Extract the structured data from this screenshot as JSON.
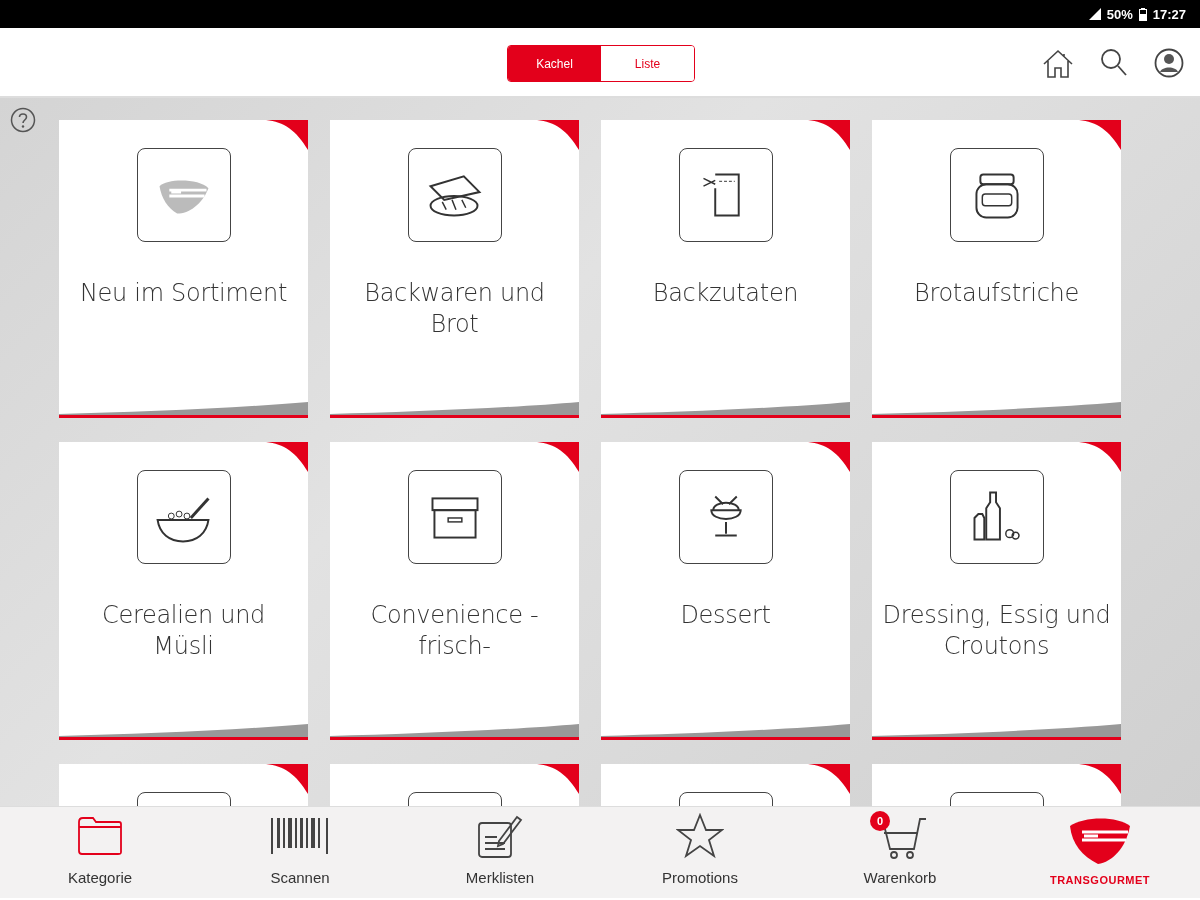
{
  "status_bar": {
    "battery": "50%",
    "time": "17:27"
  },
  "view_toggle": [
    {
      "label": "Kachel",
      "selected": true
    },
    {
      "label": "Liste",
      "selected": false
    }
  ],
  "tiles": [
    {
      "kind": "full",
      "label": "Neu im Sortiment"
    },
    {
      "kind": "full",
      "label": "Backwaren und Brot"
    },
    {
      "kind": "full",
      "label": "Backzutaten"
    },
    {
      "kind": "full",
      "label": "Brotaufstriche"
    },
    {
      "kind": "full",
      "label": "Cerealien und Müsli"
    },
    {
      "kind": "full",
      "label": "Convenience - frisch-"
    },
    {
      "kind": "full",
      "label": "Dessert"
    },
    {
      "kind": "full",
      "label": "Dressing, Essig und Croutons"
    },
    {
      "kind": "partial"
    },
    {
      "kind": "partial"
    },
    {
      "kind": "partial"
    },
    {
      "kind": "partial"
    }
  ],
  "nav": [
    {
      "kind": "folder",
      "label": "Kategorie",
      "selected": true
    },
    {
      "kind": "barcode",
      "label": "Scannen",
      "selected": false
    },
    {
      "kind": "list",
      "label": "Merklisten",
      "selected": false
    },
    {
      "kind": "star",
      "label": "Promotions",
      "selected": false
    },
    {
      "kind": "cart",
      "label": "Warenkorb",
      "selected": false,
      "badge": "0"
    },
    {
      "kind": "logo",
      "label": "TRANSGOURMET"
    }
  ]
}
